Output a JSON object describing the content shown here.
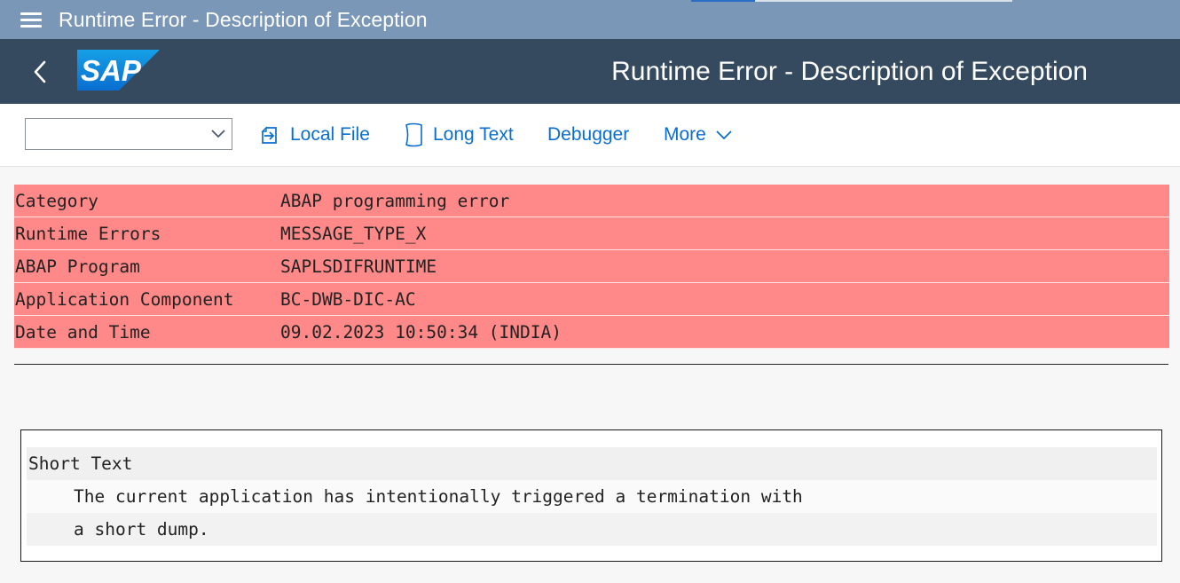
{
  "window": {
    "title": "Runtime Error - Description of Exception"
  },
  "shell": {
    "title": "Runtime Error - Description of Exception",
    "logo_text": "SAP"
  },
  "toolbar": {
    "combo_value": "",
    "local_file": "Local File",
    "long_text": "Long Text",
    "debugger": "Debugger",
    "more": "More"
  },
  "header_info": [
    {
      "label": "Category",
      "value": "ABAP programming error"
    },
    {
      "label": "Runtime Errors",
      "value": "MESSAGE_TYPE_X"
    },
    {
      "label": "ABAP Program",
      "value": "SAPLSDIFRUNTIME"
    },
    {
      "label": "Application Component",
      "value": "BC-DWB-DIC-AC"
    },
    {
      "label": "Date and Time",
      "value": "09.02.2023 10:50:34 (INDIA)"
    }
  ],
  "short_text": {
    "heading": "Short Text",
    "lines": [
      "The current application has intentionally triggered a termination with",
      "a short dump."
    ]
  },
  "colors": {
    "title_bar": "#7a97b7",
    "shell_bar": "#354a5f",
    "link": "#0a6ed1",
    "error_row": "#ff8888"
  }
}
